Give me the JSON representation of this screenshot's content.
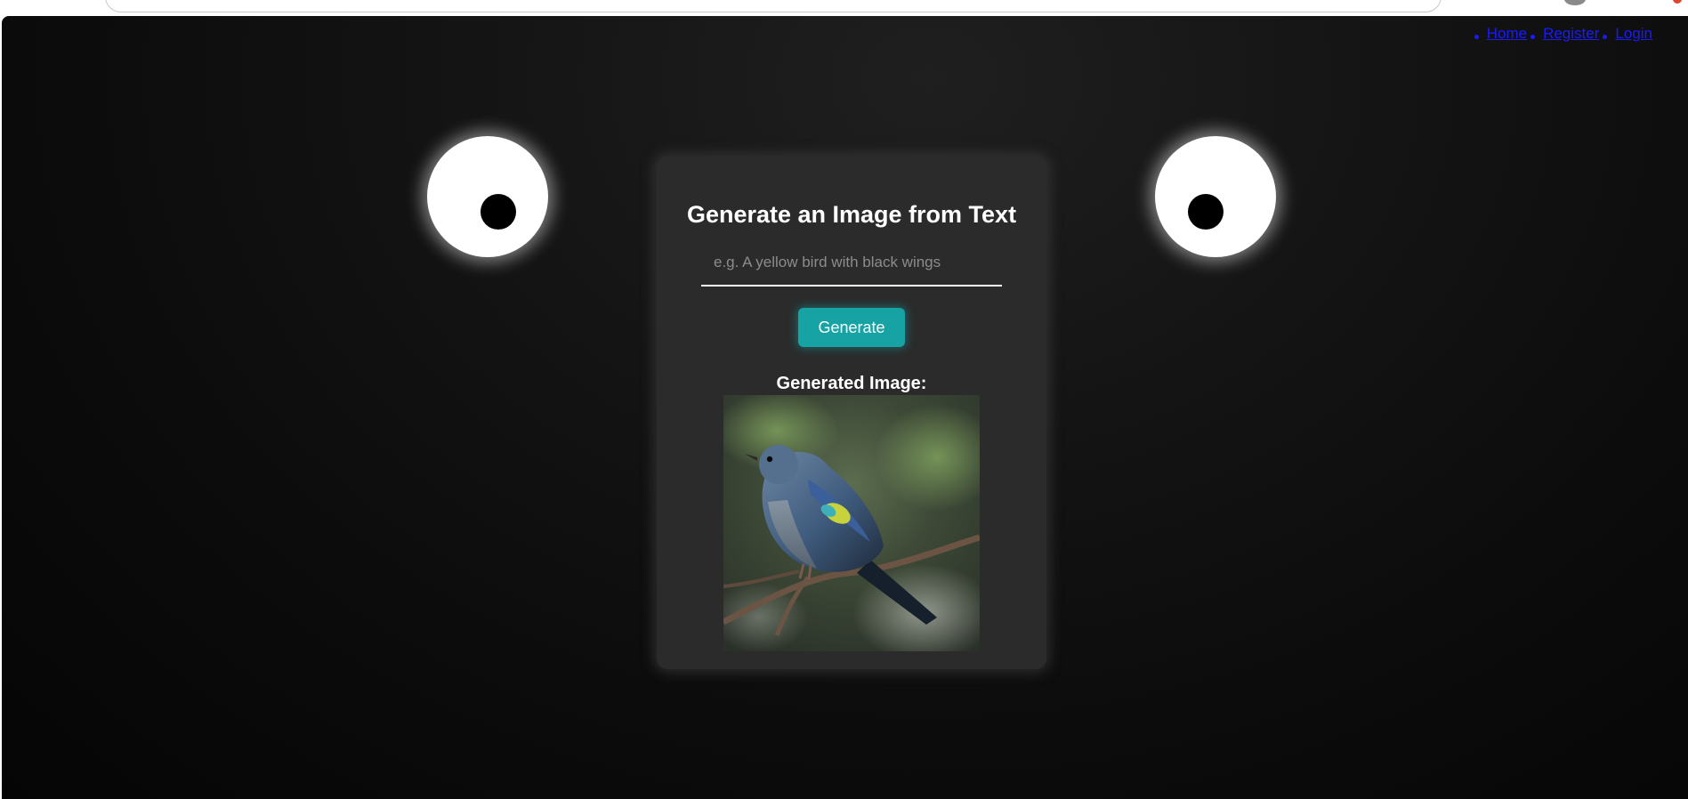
{
  "nav": {
    "items": [
      {
        "label": "Home"
      },
      {
        "label": "Register"
      },
      {
        "label": "Login"
      }
    ]
  },
  "card": {
    "title": "Generate an Image from Text",
    "prompt_placeholder": "e.g. A yellow bird with black wings",
    "prompt_value": "",
    "generate_label": "Generate",
    "generated_label": "Generated Image:"
  },
  "colors": {
    "accent": "#17a2a4",
    "link": "#1a1aff",
    "card_bg": "#2b2b2b",
    "page_bg": "#0c0c0c"
  },
  "image": {
    "subject": "blue bird perched on a branch"
  }
}
